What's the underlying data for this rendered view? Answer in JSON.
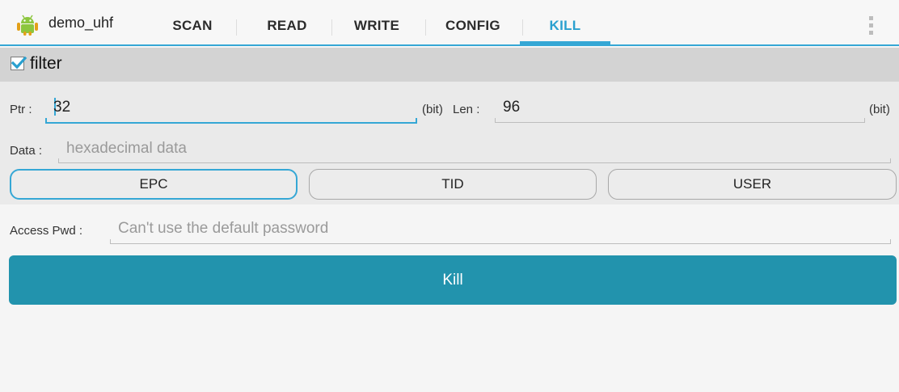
{
  "app": {
    "title": "demo_uhf"
  },
  "tabs": [
    {
      "label": "SCAN",
      "active": false
    },
    {
      "label": "READ",
      "active": false
    },
    {
      "label": "WRITE",
      "active": false
    },
    {
      "label": "CONFIG",
      "active": false
    },
    {
      "label": "KILL",
      "active": true
    }
  ],
  "filter": {
    "label": "filter",
    "checked": true,
    "ptr": {
      "label": "Ptr :",
      "value": "32",
      "unit": "(bit)"
    },
    "len": {
      "label": "Len :",
      "value": "96",
      "unit": "(bit)"
    },
    "data": {
      "label": "Data :",
      "value": "",
      "placeholder": "hexadecimal data"
    },
    "banks": [
      {
        "label": "EPC",
        "selected": true
      },
      {
        "label": "TID",
        "selected": false
      },
      {
        "label": "USER",
        "selected": false
      }
    ]
  },
  "access": {
    "label": "Access Pwd :",
    "value": "",
    "placeholder": "Can't use the default password"
  },
  "kill_button": {
    "label": "Kill"
  },
  "colors": {
    "accent": "#35a7d5",
    "kill_button": "#2293ad",
    "filter_header": "#d3d3d3",
    "filter_body": "#eaeaea"
  },
  "icons": {
    "app": "android-icon",
    "checkbox": "checkmark-icon",
    "overflow": "overflow-menu-icon"
  }
}
